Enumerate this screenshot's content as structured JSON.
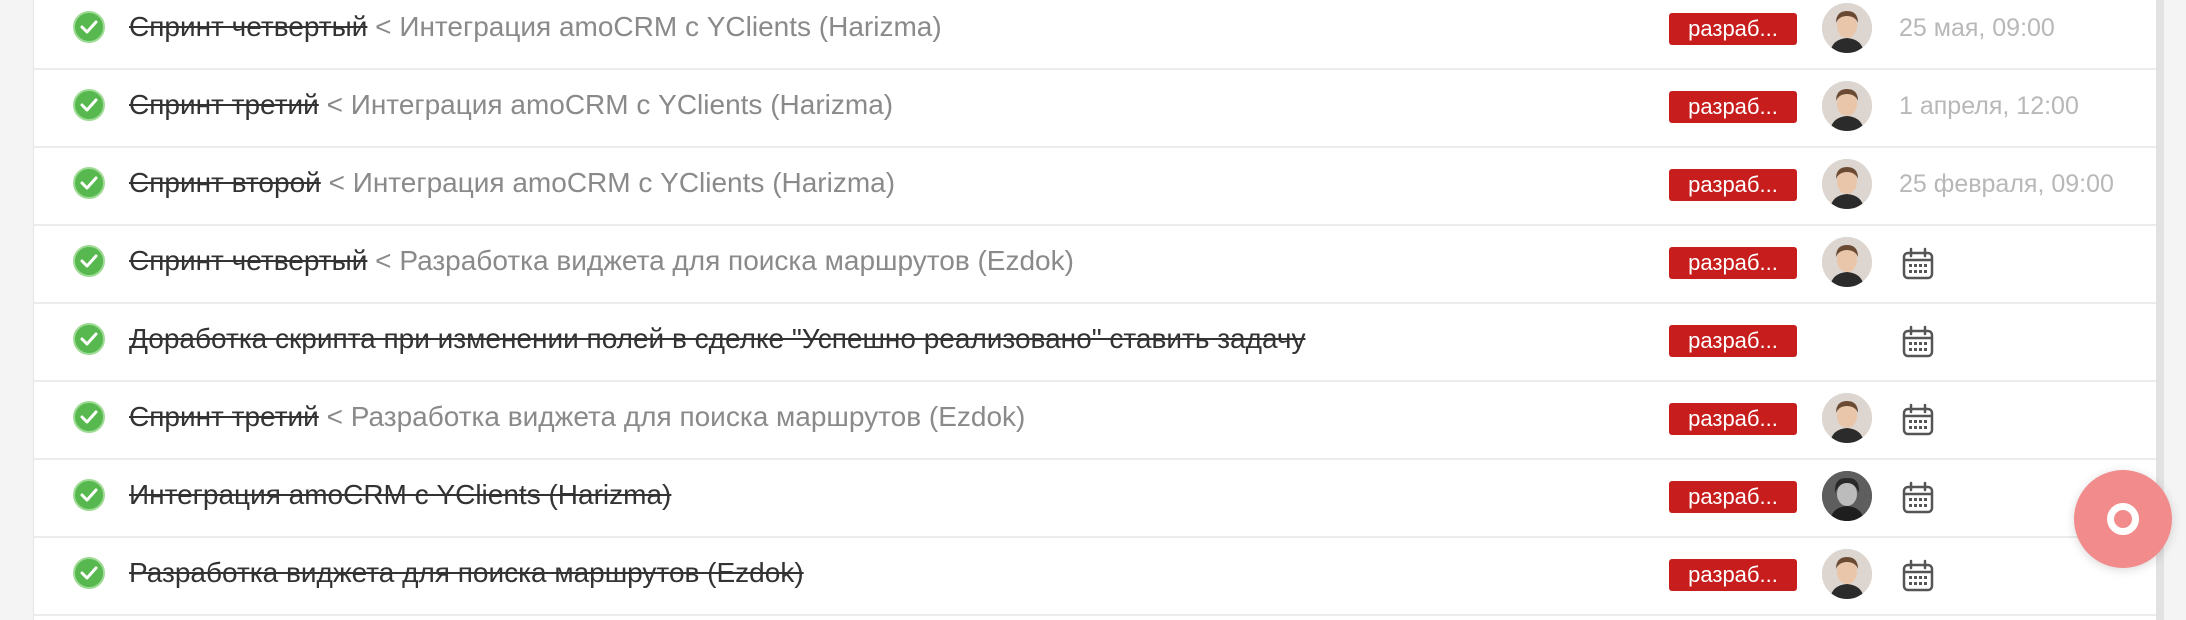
{
  "tasks": [
    {
      "title": "Спринт четвертый",
      "parent": " < Интеграция amoCRM с YClients (Harizma)",
      "tag": "разраб...",
      "assignee": "avatar-man",
      "date": "25 мая, 09:00"
    },
    {
      "title": "Спринт третий",
      "parent": " < Интеграция amoCRM с YClients (Harizma)",
      "tag": "разраб...",
      "assignee": "avatar-man",
      "date": "1 апреля, 12:00"
    },
    {
      "title": "Спринт второй",
      "parent": " < Интеграция amoCRM с YClients (Harizma)",
      "tag": "разраб...",
      "assignee": "avatar-man",
      "date": "25 февраля, 09:00"
    },
    {
      "title": "Спринт четвертый",
      "parent": " < Разработка виджета для поиска маршрутов (Ezdok)",
      "tag": "разраб...",
      "assignee": "avatar-man",
      "date": ""
    },
    {
      "title": "Доработка скрипта при изменении полей в сделке \"Успешно реализовано\" ставить задачу",
      "parent": "",
      "tag": "разраб...",
      "assignee": "",
      "date": ""
    },
    {
      "title": "Спринт третий",
      "parent": " < Разработка виджета для поиска маршрутов (Ezdok)",
      "tag": "разраб...",
      "assignee": "avatar-man",
      "date": ""
    },
    {
      "title": "Интеграция amoCRM с YClients (Harizma)",
      "parent": "",
      "tag": "разраб...",
      "assignee": "avatar-mono",
      "date": ""
    },
    {
      "title": "Разработка виджета для поиска маршрутов (Ezdok)",
      "parent": "",
      "tag": "разраб...",
      "assignee": "avatar-man",
      "date": ""
    }
  ],
  "icons": {
    "status": "check-circle-icon",
    "no_date": "calendar-icon",
    "support": "lifebuoy-icon"
  },
  "colors": {
    "tag": "#c81d1d",
    "check": "#57b84f",
    "fab": "#f28c8c"
  }
}
